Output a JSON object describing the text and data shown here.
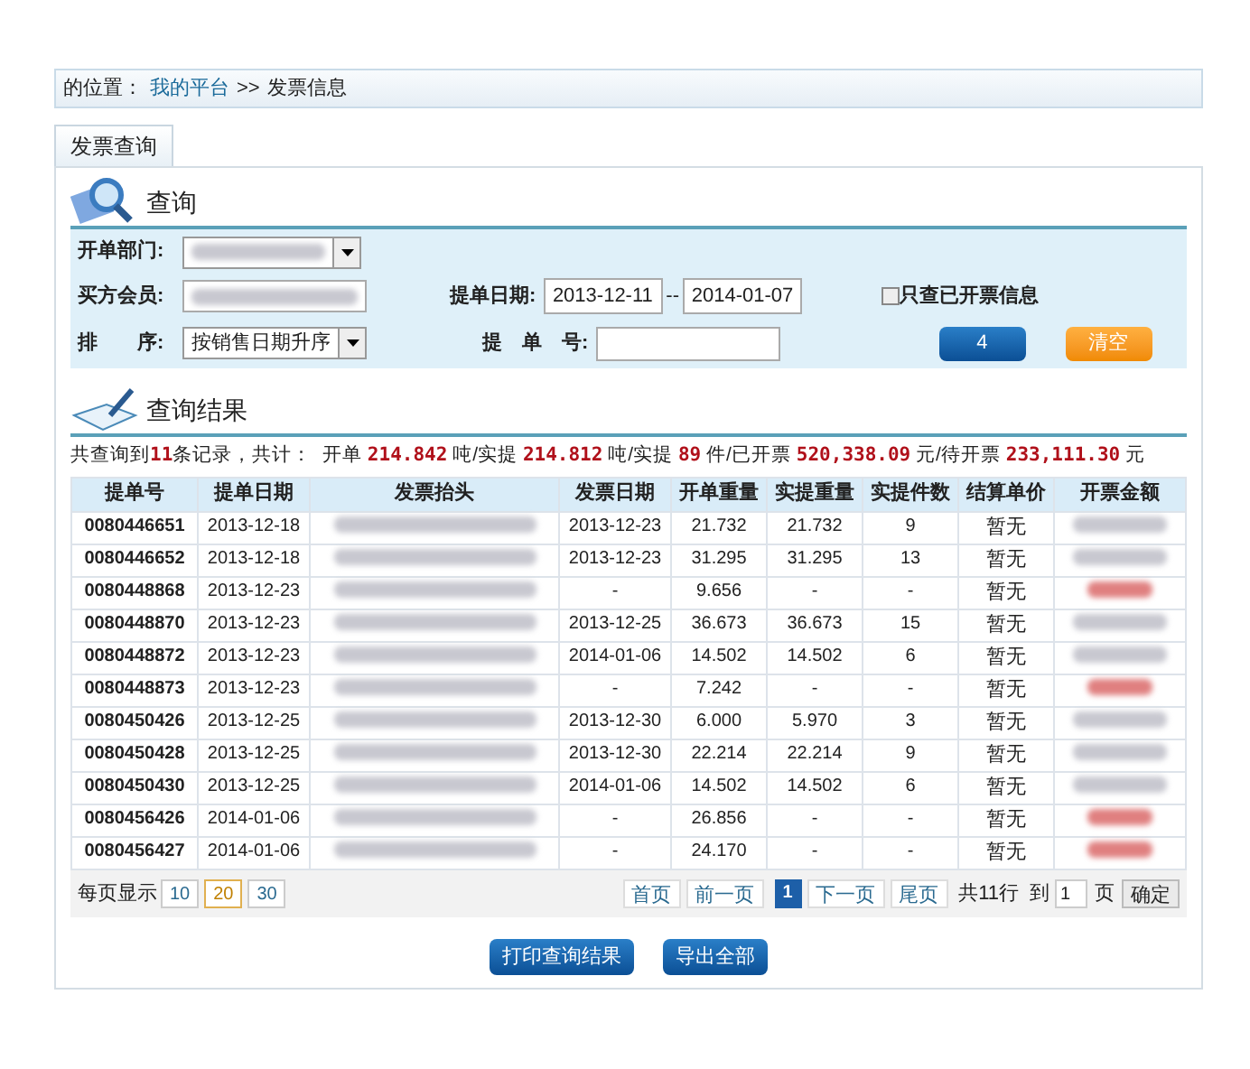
{
  "breadcrumb": {
    "prefix": "的位置：",
    "link": "我的平台",
    "separator": ">>",
    "current": "发票信息"
  },
  "tabs": [
    {
      "label": "发票查询",
      "selected": true
    }
  ],
  "query": {
    "title": "查询",
    "department": {
      "label": "开单部门:"
    },
    "buyer": {
      "label": "买方会员:"
    },
    "sort": {
      "label": "排　　序:",
      "value": "按销售日期升序"
    },
    "date": {
      "label": "提单日期:",
      "start": "2013-12-11",
      "separator": "--",
      "end": "2014-01-07"
    },
    "order_no": {
      "label": "提　单　号:"
    },
    "invoiced_only": {
      "label": "只查已开票信息",
      "checked": false
    },
    "buttons": [
      {
        "label": "4",
        "kind": "primary"
      },
      {
        "label": "清空",
        "kind": "warning"
      }
    ]
  },
  "results": {
    "title": "查询结果",
    "summary": [
      {
        "kind": "text",
        "text": "共查询到"
      },
      {
        "kind": "value",
        "text": "11"
      },
      {
        "kind": "text",
        "text": "条记录，共计：  开单 "
      },
      {
        "kind": "value",
        "text": "214.842"
      },
      {
        "kind": "text",
        "text": " 吨/实提 "
      },
      {
        "kind": "value",
        "text": "214.812"
      },
      {
        "kind": "text",
        "text": " 吨/实提 "
      },
      {
        "kind": "value",
        "text": "89"
      },
      {
        "kind": "text",
        "text": " 件/已开票 "
      },
      {
        "kind": "value",
        "text": "520,338.09"
      },
      {
        "kind": "text",
        "text": " 元/待开票 "
      },
      {
        "kind": "value",
        "text": "233,111.30"
      },
      {
        "kind": "text",
        "text": " 元"
      }
    ],
    "table": {
      "columns": [
        "提单号",
        "提单日期",
        "发票抬头",
        "发票日期",
        "开单重量",
        "实提重量",
        "实提件数",
        "结算单价",
        "开票金额"
      ],
      "rows": [
        {
          "id": "0080446651",
          "date": "2013-12-18",
          "invoice_date": "2013-12-23",
          "open_weight": "21.732",
          "actual_weight": "21.732",
          "pieces": "9",
          "unit_price": "暂无",
          "invoiced": true
        },
        {
          "id": "0080446652",
          "date": "2013-12-18",
          "invoice_date": "2013-12-23",
          "open_weight": "31.295",
          "actual_weight": "31.295",
          "pieces": "13",
          "unit_price": "暂无",
          "invoiced": true
        },
        {
          "id": "0080448868",
          "date": "2013-12-23",
          "invoice_date": "-",
          "open_weight": "9.656",
          "actual_weight": "-",
          "pieces": "-",
          "unit_price": "暂无",
          "invoiced": false
        },
        {
          "id": "0080448870",
          "date": "2013-12-23",
          "invoice_date": "2013-12-25",
          "open_weight": "36.673",
          "actual_weight": "36.673",
          "pieces": "15",
          "unit_price": "暂无",
          "invoiced": true
        },
        {
          "id": "0080448872",
          "date": "2013-12-23",
          "invoice_date": "2014-01-06",
          "open_weight": "14.502",
          "actual_weight": "14.502",
          "pieces": "6",
          "unit_price": "暂无",
          "invoiced": true
        },
        {
          "id": "0080448873",
          "date": "2013-12-23",
          "invoice_date": "-",
          "open_weight": "7.242",
          "actual_weight": "-",
          "pieces": "-",
          "unit_price": "暂无",
          "invoiced": false
        },
        {
          "id": "0080450426",
          "date": "2013-12-25",
          "invoice_date": "2013-12-30",
          "open_weight": "6.000",
          "actual_weight": "5.970",
          "pieces": "3",
          "unit_price": "暂无",
          "invoiced": true
        },
        {
          "id": "0080450428",
          "date": "2013-12-25",
          "invoice_date": "2013-12-30",
          "open_weight": "22.214",
          "actual_weight": "22.214",
          "pieces": "9",
          "unit_price": "暂无",
          "invoiced": true
        },
        {
          "id": "0080450430",
          "date": "2013-12-25",
          "invoice_date": "2014-01-06",
          "open_weight": "14.502",
          "actual_weight": "14.502",
          "pieces": "6",
          "unit_price": "暂无",
          "invoiced": true
        },
        {
          "id": "0080456426",
          "date": "2014-01-06",
          "invoice_date": "-",
          "open_weight": "26.856",
          "actual_weight": "-",
          "pieces": "-",
          "unit_price": "暂无",
          "invoiced": false
        },
        {
          "id": "0080456427",
          "date": "2014-01-06",
          "invoice_date": "-",
          "open_weight": "24.170",
          "actual_weight": "-",
          "pieces": "-",
          "unit_price": "暂无",
          "invoiced": false
        }
      ]
    },
    "pagination": {
      "page_size_label": "每页显示",
      "page_sizes": [
        {
          "label": "10",
          "selected": false
        },
        {
          "label": "20",
          "selected": true
        },
        {
          "label": "30",
          "selected": false
        }
      ],
      "prev_links": [
        "首页",
        "前一页"
      ],
      "pages": [
        {
          "label": "1",
          "selected": true
        }
      ],
      "next_links": [
        "下一页",
        "尾页"
      ],
      "total": "共11行",
      "goto_label": "到",
      "goto_value": "1",
      "page_unit": "页",
      "confirm": "确定"
    },
    "actions": [
      "打印查询结果",
      "导出全部"
    ]
  }
}
